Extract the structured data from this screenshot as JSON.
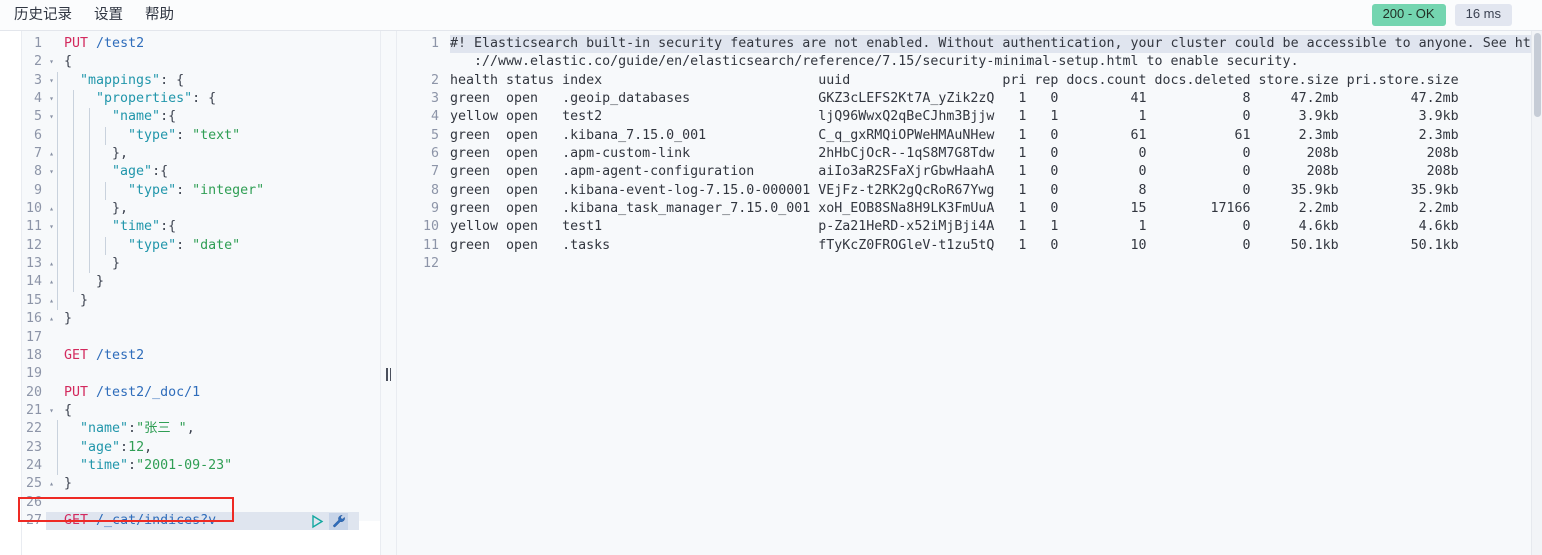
{
  "menu": {
    "items": [
      {
        "label": "历史记录",
        "name": "menu-history"
      },
      {
        "label": "设置",
        "name": "menu-settings"
      },
      {
        "label": "帮助",
        "name": "menu-help"
      }
    ]
  },
  "status": {
    "code_label": "200 - OK",
    "time_label": "16 ms",
    "ok_color": "#74d5b0",
    "time_bg": "#e2e6f0"
  },
  "request_editor": {
    "active_line": 27,
    "run_icon": "play-icon",
    "tools_icon": "wrench-icon",
    "lines": [
      {
        "n": "1",
        "fold": "",
        "tokens": [
          {
            "t": "PUT",
            "c": "kw"
          },
          {
            "t": " ",
            "c": "punct"
          },
          {
            "t": "/test2",
            "c": "url"
          }
        ]
      },
      {
        "n": "2",
        "fold": "▾",
        "tokens": [
          {
            "t": "{",
            "c": "punct"
          }
        ]
      },
      {
        "n": "3",
        "fold": "▾",
        "tokens": [
          {
            "t": "  \"mappings\"",
            "c": "key"
          },
          {
            "t": ": {",
            "c": "punct"
          }
        ]
      },
      {
        "n": "4",
        "fold": "▾",
        "tokens": [
          {
            "t": "    \"properties\"",
            "c": "key"
          },
          {
            "t": ": {",
            "c": "punct"
          }
        ]
      },
      {
        "n": "5",
        "fold": "▾",
        "tokens": [
          {
            "t": "      \"name\"",
            "c": "key"
          },
          {
            "t": ":{",
            "c": "punct"
          }
        ]
      },
      {
        "n": "6",
        "fold": "",
        "tokens": [
          {
            "t": "        \"type\"",
            "c": "key"
          },
          {
            "t": ": ",
            "c": "punct"
          },
          {
            "t": "\"text\"",
            "c": "str"
          }
        ]
      },
      {
        "n": "7",
        "fold": "▴",
        "tokens": [
          {
            "t": "      },",
            "c": "punct"
          }
        ]
      },
      {
        "n": "8",
        "fold": "▾",
        "tokens": [
          {
            "t": "      \"age\"",
            "c": "key"
          },
          {
            "t": ":{",
            "c": "punct"
          }
        ]
      },
      {
        "n": "9",
        "fold": "",
        "tokens": [
          {
            "t": "        \"type\"",
            "c": "key"
          },
          {
            "t": ": ",
            "c": "punct"
          },
          {
            "t": "\"integer\"",
            "c": "str"
          }
        ]
      },
      {
        "n": "10",
        "fold": "▴",
        "tokens": [
          {
            "t": "      },",
            "c": "punct"
          }
        ]
      },
      {
        "n": "11",
        "fold": "▾",
        "tokens": [
          {
            "t": "      \"time\"",
            "c": "key"
          },
          {
            "t": ":{",
            "c": "punct"
          }
        ]
      },
      {
        "n": "12",
        "fold": "",
        "tokens": [
          {
            "t": "        \"type\"",
            "c": "key"
          },
          {
            "t": ": ",
            "c": "punct"
          },
          {
            "t": "\"date\"",
            "c": "str"
          }
        ]
      },
      {
        "n": "13",
        "fold": "▴",
        "tokens": [
          {
            "t": "      }",
            "c": "punct"
          }
        ]
      },
      {
        "n": "14",
        "fold": "▴",
        "tokens": [
          {
            "t": "    }",
            "c": "punct"
          }
        ]
      },
      {
        "n": "15",
        "fold": "▴",
        "tokens": [
          {
            "t": "  }",
            "c": "punct"
          }
        ]
      },
      {
        "n": "16",
        "fold": "▴",
        "tokens": [
          {
            "t": "}",
            "c": "punct"
          }
        ]
      },
      {
        "n": "17",
        "fold": "",
        "tokens": []
      },
      {
        "n": "18",
        "fold": "",
        "tokens": [
          {
            "t": "GET",
            "c": "kw"
          },
          {
            "t": " ",
            "c": "punct"
          },
          {
            "t": "/test2",
            "c": "url"
          }
        ]
      },
      {
        "n": "19",
        "fold": "",
        "tokens": []
      },
      {
        "n": "20",
        "fold": "",
        "tokens": [
          {
            "t": "PUT",
            "c": "kw"
          },
          {
            "t": " ",
            "c": "punct"
          },
          {
            "t": "/test2/_doc/1",
            "c": "url"
          }
        ]
      },
      {
        "n": "21",
        "fold": "▾",
        "tokens": [
          {
            "t": "{",
            "c": "punct"
          }
        ]
      },
      {
        "n": "22",
        "fold": "",
        "tokens": [
          {
            "t": "  \"name\"",
            "c": "key"
          },
          {
            "t": ":",
            "c": "punct"
          },
          {
            "t": "\"张三 \"",
            "c": "str"
          },
          {
            "t": ",",
            "c": "punct"
          }
        ]
      },
      {
        "n": "23",
        "fold": "",
        "tokens": [
          {
            "t": "  \"age\"",
            "c": "key"
          },
          {
            "t": ":",
            "c": "punct"
          },
          {
            "t": "12",
            "c": "num"
          },
          {
            "t": ",",
            "c": "punct"
          }
        ]
      },
      {
        "n": "24",
        "fold": "",
        "tokens": [
          {
            "t": "  \"time\"",
            "c": "key"
          },
          {
            "t": ":",
            "c": "punct"
          },
          {
            "t": "\"2001-09-23\"",
            "c": "str"
          }
        ]
      },
      {
        "n": "25",
        "fold": "▴",
        "tokens": [
          {
            "t": "}",
            "c": "punct"
          }
        ]
      },
      {
        "n": "26",
        "fold": "",
        "tokens": []
      },
      {
        "n": "27",
        "fold": "",
        "tokens": [
          {
            "t": "GET",
            "c": "kw"
          },
          {
            "t": " ",
            "c": "punct"
          },
          {
            "t": "/_cat/indices?v",
            "c": "url"
          }
        ]
      }
    ]
  },
  "response": {
    "warning_line_number": "1",
    "warning_text_1": "#! Elasticsearch built-in security features are not enabled. Without authentication, your cluster could be accessible to anyone. See https",
    "warning_text_2": "   ://www.elastic.co/guide/en/elasticsearch/reference/7.15/security-minimal-setup.html to enable security.",
    "table_header_line_number": "2",
    "table_header": "health status index                           uuid                   pri rep docs.count docs.deleted store.size pri.store.size",
    "rows": [
      {
        "n": "3",
        "text": "green  open   .geoip_databases                GKZ3cLEFS2Kt7A_yZik2zQ   1   0         41            8     47.2mb         47.2mb"
      },
      {
        "n": "4",
        "text": "yellow open   test2                           ljQ96WwxQ2qBeCJhm3Bjjw   1   1          1            0      3.9kb          3.9kb"
      },
      {
        "n": "5",
        "text": "green  open   .kibana_7.15.0_001              C_q_gxRMQiOPWeHMAuNHew   1   0         61           61      2.3mb          2.3mb"
      },
      {
        "n": "6",
        "text": "green  open   .apm-custom-link                2hHbCjOcR--1qS8M7G8Tdw   1   0          0            0       208b           208b"
      },
      {
        "n": "7",
        "text": "green  open   .apm-agent-configuration        aiIo3aR2SFaXjrGbwHaahA   1   0          0            0       208b           208b"
      },
      {
        "n": "8",
        "text": "green  open   .kibana-event-log-7.15.0-000001 VEjFz-t2RK2gQcRoR67Ywg   1   0          8            0     35.9kb         35.9kb"
      },
      {
        "n": "9",
        "text": "green  open   .kibana_task_manager_7.15.0_001 xoH_EOB8SNa8H9LK3FmUuA   1   0         15        17166      2.2mb          2.2mb"
      },
      {
        "n": "10",
        "text": "yellow open   test1                           p-Za21HeRD-x52iMjBji4A   1   1          1            0      4.6kb          4.6kb"
      },
      {
        "n": "11",
        "text": "green  open   .tasks                          fTyKcZ0FROGleV-t1zu5tQ   1   0         10            0     50.1kb         50.1kb"
      },
      {
        "n": "12",
        "text": ""
      }
    ],
    "table_data": {
      "columns": [
        "health",
        "status",
        "index",
        "uuid",
        "pri",
        "rep",
        "docs.count",
        "docs.deleted",
        "store.size",
        "pri.store.size"
      ],
      "values": [
        [
          "green",
          "open",
          ".geoip_databases",
          "GKZ3cLEFS2Kt7A_yZik2zQ",
          "1",
          "0",
          "41",
          "8",
          "47.2mb",
          "47.2mb"
        ],
        [
          "yellow",
          "open",
          "test2",
          "ljQ96WwxQ2qBeCJhm3Bjjw",
          "1",
          "1",
          "1",
          "0",
          "3.9kb",
          "3.9kb"
        ],
        [
          "green",
          "open",
          ".kibana_7.15.0_001",
          "C_q_gxRMQiOPWeHMAuNHew",
          "1",
          "0",
          "61",
          "61",
          "2.3mb",
          "2.3mb"
        ],
        [
          "green",
          "open",
          ".apm-custom-link",
          "2hHbCjOcR--1qS8M7G8Tdw",
          "1",
          "0",
          "0",
          "0",
          "208b",
          "208b"
        ],
        [
          "green",
          "open",
          ".apm-agent-configuration",
          "aiIo3aR2SFaXjrGbwHaahA",
          "1",
          "0",
          "0",
          "0",
          "208b",
          "208b"
        ],
        [
          "green",
          "open",
          ".kibana-event-log-7.15.0-000001",
          "VEjFz-t2RK2gQcRoR67Ywg",
          "1",
          "0",
          "8",
          "0",
          "35.9kb",
          "35.9kb"
        ],
        [
          "green",
          "open",
          ".kibana_task_manager_7.15.0_001",
          "xoH_EOB8SNa8H9LK3FmUuA",
          "1",
          "0",
          "15",
          "17166",
          "2.2mb",
          "2.2mb"
        ],
        [
          "yellow",
          "open",
          "test1",
          "p-Za21HeRD-x52iMjBji4A",
          "1",
          "1",
          "1",
          "0",
          "4.6kb",
          "4.6kb"
        ],
        [
          "green",
          "open",
          ".tasks",
          "fTyKcZ0FROGleV-t1zu5tQ",
          "1",
          "0",
          "10",
          "0",
          "50.1kb",
          "50.1kb"
        ]
      ]
    }
  },
  "annotation": {
    "color": "#ee2a24",
    "target_line": "27"
  }
}
